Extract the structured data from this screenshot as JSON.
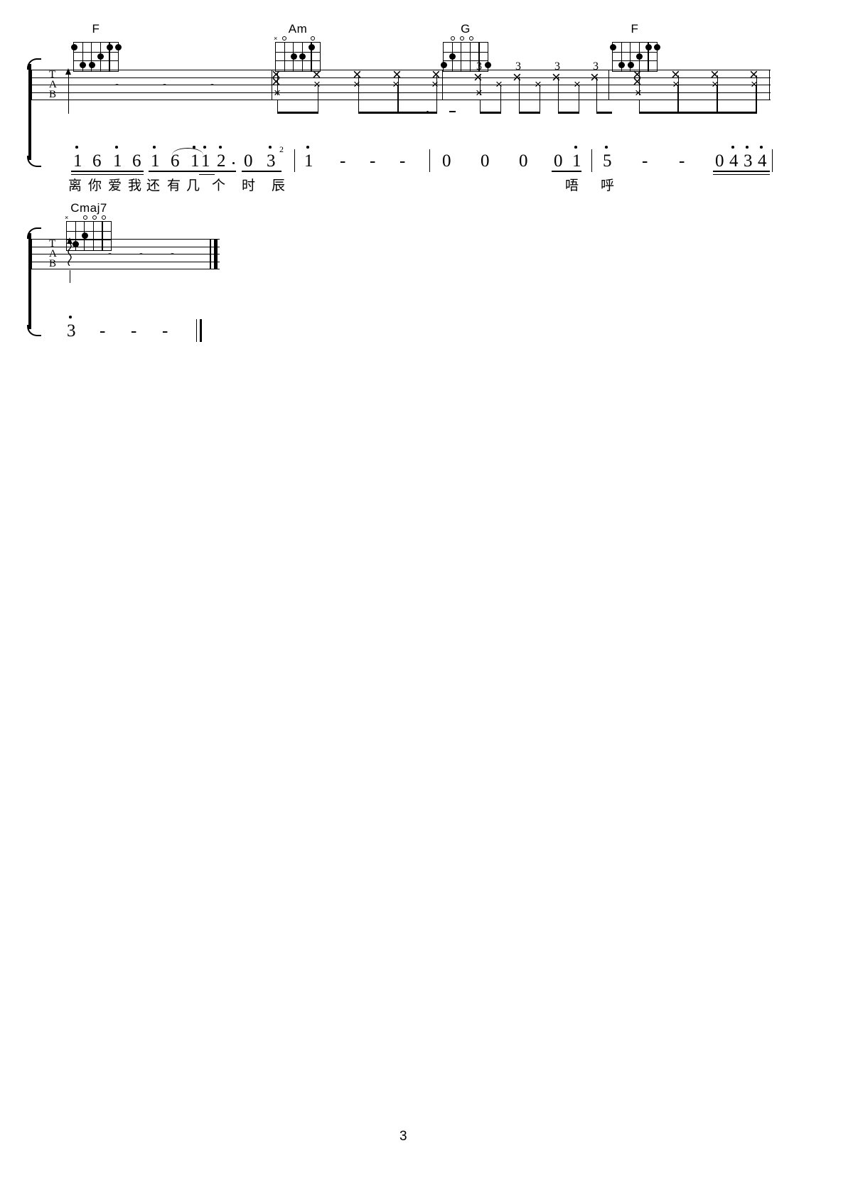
{
  "page": {
    "number": "3",
    "background": "#ffffff",
    "ink": "#000000"
  },
  "systems": [
    {
      "id": "system-1",
      "tab_labels": [
        "T",
        "A",
        "B"
      ],
      "measures": [
        {
          "chord": {
            "name": "F",
            "open_marks": [
              "",
              "",
              "",
              "",
              "",
              ""
            ],
            "dots": [
              {
                "string": 6,
                "fret": 1
              },
              {
                "string": 5,
                "fret": 3
              },
              {
                "string": 4,
                "fret": 3
              },
              {
                "string": 3,
                "fret": 2
              },
              {
                "string": 2,
                "fret": 1
              },
              {
                "string": 1,
                "fret": 1
              }
            ]
          },
          "content": "whole-rest-strum",
          "rest_dashes": [
            "-",
            "-",
            "-"
          ]
        },
        {
          "chord": {
            "name": "Am",
            "open_marks": [
              "x",
              "o",
              "",
              "",
              "",
              "o"
            ],
            "dots": [
              {
                "string": 4,
                "fret": 2
              },
              {
                "string": 3,
                "fret": 2
              },
              {
                "string": 2,
                "fret": 1
              }
            ]
          },
          "content": "strum-x",
          "beats": [
            "x",
            "x",
            "x",
            "x",
            "x"
          ]
        },
        {
          "chord": {
            "name": "G",
            "open_marks": [
              "",
              "o",
              "o",
              "o",
              "",
              ""
            ],
            "dots": [
              {
                "string": 6,
                "fret": 3
              },
              {
                "string": 5,
                "fret": 2
              },
              {
                "string": 1,
                "fret": 3
              }
            ]
          },
          "content": "strum-x-with-fret3",
          "fret_numbers": [
            "3",
            "3",
            "3",
            "3",
            "3"
          ]
        },
        {
          "chord": {
            "name": "F",
            "open_marks": [
              "",
              "",
              "",
              "",
              "",
              ""
            ],
            "dots": [
              {
                "string": 6,
                "fret": 1
              },
              {
                "string": 5,
                "fret": 3
              },
              {
                "string": 4,
                "fret": 3
              },
              {
                "string": 3,
                "fret": 2
              },
              {
                "string": 2,
                "fret": 1
              },
              {
                "string": 1,
                "fret": 1
              }
            ]
          },
          "content": "strum-x",
          "beats": [
            "x",
            "x",
            "x",
            "x",
            "x"
          ]
        }
      ],
      "melody": {
        "notes": [
          {
            "n": "1",
            "octave": "high",
            "beam": 2
          },
          {
            "n": "6",
            "octave": "",
            "beam": 2
          },
          {
            "n": "1",
            "octave": "high",
            "beam": 2
          },
          {
            "n": "6",
            "octave": "",
            "beam": 2
          },
          {
            "n": "1",
            "octave": "high",
            "beam": 1
          },
          {
            "n": "6",
            "octave": "",
            "beam": 1
          },
          {
            "n": "1",
            "octave": "high",
            "beam": 1
          },
          {
            "n": "1",
            "octave": "high",
            "beam": 2
          },
          {
            "n": "2",
            "octave": "high",
            "beam": 1,
            "dotted": true
          },
          {
            "n": "0",
            "octave": "",
            "beam": 1
          },
          {
            "n": "3",
            "octave": "high",
            "beam": 1,
            "triplet": "2"
          },
          {
            "n": "1",
            "octave": "high",
            "beam": 0
          },
          {
            "n": "-",
            "octave": "",
            "beam": 0
          },
          {
            "n": "-",
            "octave": "",
            "beam": 0
          },
          {
            "n": "-",
            "octave": "",
            "beam": 0
          },
          {
            "n": "0",
            "octave": "",
            "beam": 0
          },
          {
            "n": "0",
            "octave": "",
            "beam": 0
          },
          {
            "n": "0",
            "octave": "",
            "beam": 0
          },
          {
            "n": "0",
            "octave": "",
            "beam": 1
          },
          {
            "n": "1",
            "octave": "high",
            "beam": 1
          },
          {
            "n": "5",
            "octave": "high",
            "beam": 0
          },
          {
            "n": "-",
            "octave": "",
            "beam": 0
          },
          {
            "n": "-",
            "octave": "",
            "beam": 0
          },
          {
            "n": "0",
            "octave": "",
            "beam": 2
          },
          {
            "n": "4",
            "octave": "high",
            "beam": 2
          },
          {
            "n": "3",
            "octave": "high",
            "beam": 2
          },
          {
            "n": "4",
            "octave": "high",
            "beam": 2
          }
        ],
        "lyrics": [
          "离",
          "你",
          "爱",
          "我",
          "还",
          "有",
          "几",
          "个",
          "时",
          "辰",
          "唔",
          "呼"
        ]
      }
    },
    {
      "id": "system-2",
      "tab_labels": [
        "T",
        "A",
        "B"
      ],
      "measures": [
        {
          "chord": {
            "name": "Cmaj7",
            "open_marks": [
              "x",
              "",
              "",
              "o",
              "o",
              "o"
            ],
            "dots": [
              {
                "string": 5,
                "fret": 3
              },
              {
                "string": 4,
                "fret": 2
              }
            ]
          },
          "content": "arpeggio-rest",
          "rest_dashes": [
            "-",
            "-",
            "-"
          ]
        }
      ],
      "melody": {
        "notes": [
          {
            "n": "3",
            "octave": "high",
            "beam": 0
          },
          {
            "n": "-",
            "octave": "",
            "beam": 0
          },
          {
            "n": "-",
            "octave": "",
            "beam": 0
          },
          {
            "n": "-",
            "octave": "",
            "beam": 0
          }
        ],
        "lyrics": []
      }
    }
  ]
}
